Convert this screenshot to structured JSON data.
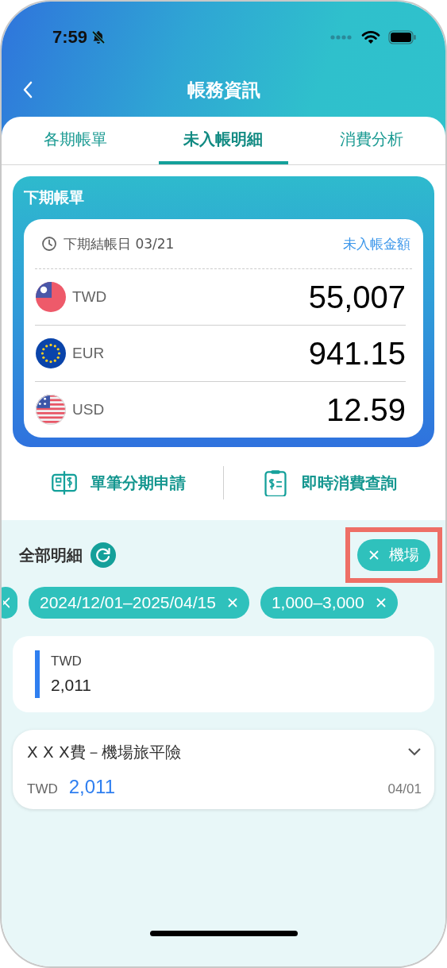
{
  "status_bar": {
    "time": "7:59",
    "silent": true
  },
  "header": {
    "title": "帳務資訊"
  },
  "tabs": [
    {
      "label": "各期帳單",
      "selected": false
    },
    {
      "label": "未入帳明細",
      "selected": true
    },
    {
      "label": "消費分析",
      "selected": false
    }
  ],
  "next_bill": {
    "title": "下期帳單",
    "closing_date": "下期結帳日 03/21",
    "amount_label": "未入帳金額",
    "currencies": [
      {
        "kind": "tw",
        "code": "TWD",
        "amount": "55,007"
      },
      {
        "kind": "eu",
        "code": "EUR",
        "amount": "941.15"
      },
      {
        "kind": "us",
        "code": "USD",
        "amount": "12.59"
      }
    ]
  },
  "actions": [
    {
      "kind": "installment",
      "label": "單筆分期申請"
    },
    {
      "kind": "query",
      "label": "即時消費查詢"
    }
  ],
  "details": {
    "title": "全部明細",
    "keyword_chip": {
      "label": "機場",
      "highlighted": true
    },
    "filter_chips": [
      {
        "kind": "cut"
      },
      {
        "kind": "full",
        "label": "2024/12/01–2025/04/15"
      },
      {
        "kind": "full",
        "label": "1,000–3,000"
      }
    ],
    "summary": {
      "currency": "TWD",
      "amount": "2,011"
    },
    "transactions": [
      {
        "title": "X X X費－機場旅平險",
        "currency": "TWD",
        "amount": "2,011",
        "date": "04/01",
        "expanded": false
      }
    ]
  }
}
